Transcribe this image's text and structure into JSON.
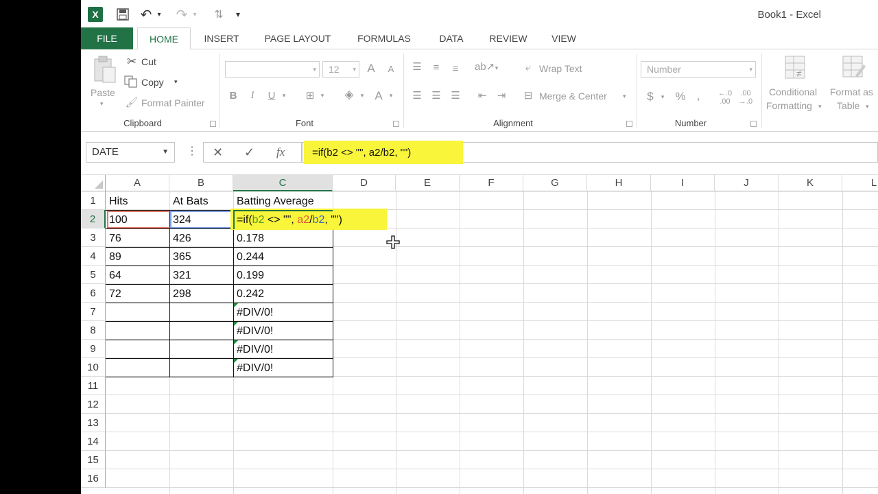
{
  "window": {
    "title": "Book1 - Excel"
  },
  "qat": {
    "excel_logo": "X",
    "save_icon": "💾",
    "undo_icon": "↶",
    "redo_icon": "↷",
    "sort_icon": "⇅",
    "customize_icon": "▾"
  },
  "tabs": [
    "FILE",
    "HOME",
    "INSERT",
    "PAGE LAYOUT",
    "FORMULAS",
    "DATA",
    "REVIEW",
    "VIEW"
  ],
  "ribbon": {
    "clipboard": {
      "paste": "Paste",
      "cut": "Cut",
      "copy": "Copy",
      "format_painter": "Format Painter",
      "label": "Clipboard"
    },
    "font": {
      "size": "12",
      "bold": "B",
      "italic": "I",
      "underline": "U",
      "label": "Font",
      "grow": "A",
      "shrink": "A"
    },
    "alignment": {
      "wrap_text": "Wrap Text",
      "merge_center": "Merge & Center",
      "label": "Alignment"
    },
    "number": {
      "format": "Number",
      "currency": "$",
      "percent": "%",
      "comma": ",",
      "label": "Number"
    },
    "styles": {
      "conditional": "Conditional",
      "formatting": "Formatting",
      "format_as": "Format as",
      "table": "Table"
    }
  },
  "formula_bar": {
    "name_box": "DATE",
    "cancel": "✕",
    "enter": "✓",
    "fx": "fx",
    "formula": "=if(b2 <> \"\", a2/b2, \"\")"
  },
  "grid": {
    "columns": [
      "A",
      "B",
      "C",
      "D",
      "E",
      "F",
      "G",
      "H",
      "I",
      "J",
      "K",
      "L"
    ],
    "rows": [
      "1",
      "2",
      "3",
      "4",
      "5",
      "6",
      "7",
      "8",
      "9",
      "10",
      "11",
      "12",
      "13",
      "14",
      "15",
      "16"
    ],
    "headers": {
      "a1": "Hits",
      "b1": "At Bats",
      "c1": "Batting Average"
    },
    "data": [
      {
        "a": "100",
        "b": "324",
        "c": ""
      },
      {
        "a": "76",
        "b": "426",
        "c": "0.178"
      },
      {
        "a": "89",
        "b": "365",
        "c": "0.244"
      },
      {
        "a": "64",
        "b": "321",
        "c": "0.199"
      },
      {
        "a": "72",
        "b": "298",
        "c": "0.242"
      },
      {
        "a": "",
        "b": "",
        "c": "#DIV/0!"
      },
      {
        "a": "",
        "b": "",
        "c": "#DIV/0!"
      },
      {
        "a": "",
        "b": "",
        "c": "#DIV/0!"
      },
      {
        "a": "",
        "b": "",
        "c": "#DIV/0!"
      }
    ],
    "edit_cell": {
      "p1": "=if(",
      "p2": "b2",
      "p3": " <> \"\", ",
      "p4": "a2",
      "p5": "/",
      "p6": "b2",
      "p7": ", \"\")"
    }
  },
  "colors": {
    "excel_green": "#217346",
    "highlight": "#f8f53a"
  }
}
